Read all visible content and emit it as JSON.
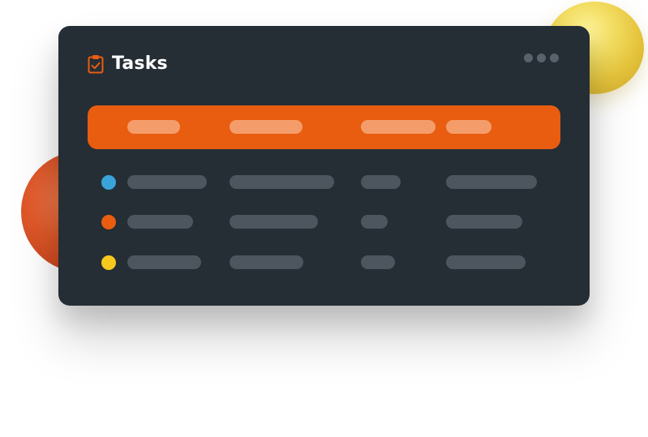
{
  "card": {
    "title": "Tasks",
    "icon": "clipboard-check-icon",
    "menu_icon": "more-horizontal-icon"
  },
  "colors": {
    "card_background": "#252d35",
    "accent": "#e85d10",
    "placeholder": "#4d565e",
    "sphere_yellow": "#f2dd62",
    "sphere_orange": "#e0582a"
  },
  "rows": [
    {
      "status_color": "#3aa3d9"
    },
    {
      "status_color": "#e85d10"
    },
    {
      "status_color": "#f7c81e"
    }
  ]
}
